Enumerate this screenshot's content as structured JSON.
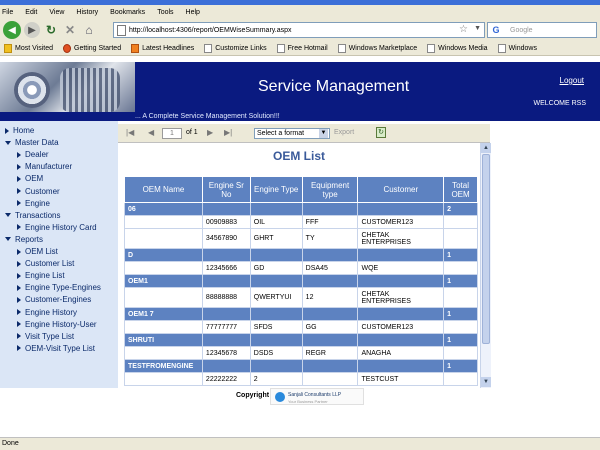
{
  "browser": {
    "menu": [
      "File",
      "Edit",
      "View",
      "History",
      "Bookmarks",
      "Tools",
      "Help"
    ],
    "url": "http://localhost:4306/report/OEMWiseSummary.aspx",
    "search_placeholder": "Google",
    "bookmarks": [
      "Most Visited",
      "Getting Started",
      "Latest Headlines",
      "Customize Links",
      "Free Hotmail",
      "Windows Marketplace",
      "Windows Media",
      "Windows"
    ],
    "status": "Done"
  },
  "header": {
    "title": "Service Management",
    "tagline": "... A Complete Service Management Solution!!!",
    "logout": "Logout",
    "welcome": "WELCOME RSS"
  },
  "sidebar": {
    "items": [
      {
        "label": "Home",
        "level": 0,
        "expanded": false
      },
      {
        "label": "Master Data",
        "level": 0,
        "expanded": true
      },
      {
        "label": "Dealer",
        "level": 1
      },
      {
        "label": "Manufacturer",
        "level": 1
      },
      {
        "label": "OEM",
        "level": 1
      },
      {
        "label": "Customer",
        "level": 1
      },
      {
        "label": "Engine",
        "level": 1
      },
      {
        "label": "Transactions",
        "level": 0,
        "expanded": true
      },
      {
        "label": "Engine History Card",
        "level": 1
      },
      {
        "label": "Reports",
        "level": 0,
        "expanded": true
      },
      {
        "label": "OEM List",
        "level": 1
      },
      {
        "label": "Customer List",
        "level": 1
      },
      {
        "label": "Engine List",
        "level": 1
      },
      {
        "label": "Engine Type-Engines",
        "level": 1
      },
      {
        "label": "Customer-Engines",
        "level": 1
      },
      {
        "label": "Engine History",
        "level": 1
      },
      {
        "label": "Engine History-User",
        "level": 1
      },
      {
        "label": "Visit Type List",
        "level": 1
      },
      {
        "label": "OEM-Visit Type List",
        "level": 1
      }
    ]
  },
  "report_toolbar": {
    "page_value": "1",
    "of_text": "of 1",
    "format_select": "Select a format",
    "export": "Export"
  },
  "report": {
    "title": "OEM List",
    "columns": [
      "OEM Name",
      "Engine Sr No",
      "Engine Type",
      "Equipment type",
      "Customer",
      "Total OEM"
    ],
    "groups": [
      {
        "name": "06",
        "total": "2",
        "rows": [
          [
            "",
            "00909883",
            "OIL",
            "FFF",
            "CUSTOMER123",
            ""
          ],
          [
            "",
            "34567890",
            "GHRT",
            "TY",
            "CHETAK ENTERPRISES",
            ""
          ]
        ]
      },
      {
        "name": "D",
        "total": "1",
        "rows": [
          [
            "",
            "12345666",
            "GD",
            "DSA45",
            "WQE",
            ""
          ]
        ]
      },
      {
        "name": "OEM1",
        "total": "1",
        "rows": [
          [
            "",
            "88888888",
            "QWERTYUI",
            "12",
            "CHETAK ENTERPRISES",
            ""
          ]
        ]
      },
      {
        "name": "OEM1 7",
        "total": "1",
        "rows": [
          [
            "",
            "77777777",
            "SFDS",
            "GG",
            "CUSTOMER123",
            ""
          ]
        ]
      },
      {
        "name": "SHRUTI",
        "total": "1",
        "rows": [
          [
            "",
            "12345678",
            "DSDS",
            "REGR",
            "ANAGHA",
            ""
          ]
        ]
      },
      {
        "name": "TESTFROMENGINE",
        "total": "1",
        "rows": [
          [
            "",
            "22222222",
            "2",
            "",
            "TESTCUST",
            ""
          ]
        ]
      }
    ]
  },
  "footer": {
    "copyright": "Copyright",
    "logo_text": "Sanjali Consultants LLP",
    "logo_sub": "Your Business Partner"
  },
  "colors": {
    "header_bg": "#0a1a80",
    "sidebar_bg": "#dbe6f6",
    "table_header": "#5d82c1",
    "title_blue": "#3a5a9a"
  }
}
